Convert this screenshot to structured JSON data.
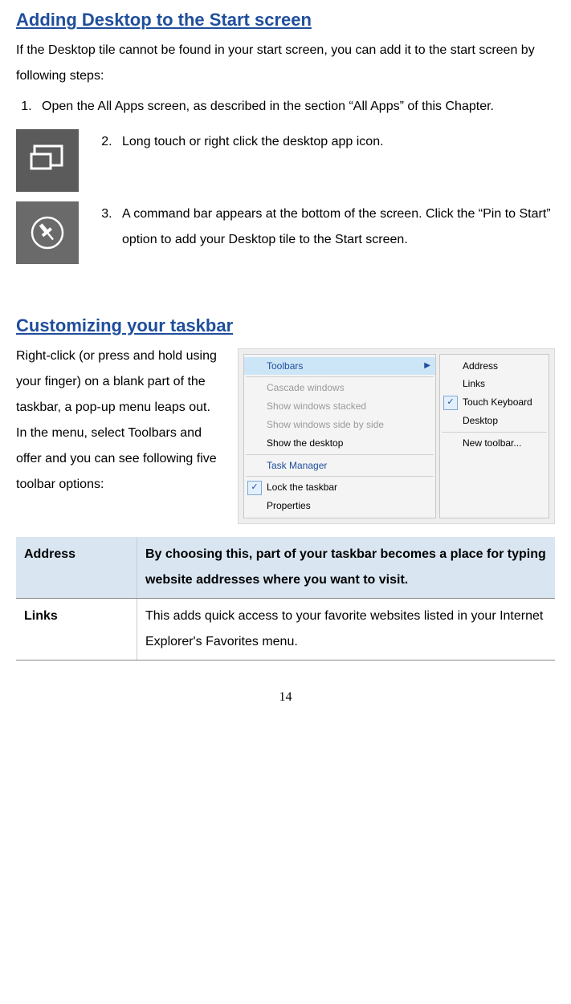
{
  "section1": {
    "heading": "Adding Desktop to the Start screen",
    "intro": "If the Desktop tile cannot be found in your start screen, you can add it to the start screen by following steps:",
    "steps": {
      "s1": "Open the All Apps screen, as described in the section “All Apps” of this Chapter.",
      "s2": "Long touch or right click the desktop app icon.",
      "s3": "A command bar appears at the bottom of the screen. Click the “Pin to Start” option to add your Desktop tile to the Start screen."
    }
  },
  "section2": {
    "heading": "Customizing your taskbar",
    "body": "Right-click (or press and hold using your finger) on a blank part of the taskbar, a pop-up menu leaps out. In the menu, select Toolbars and offer and you can see following five toolbar options:"
  },
  "menu": {
    "main": {
      "toolbars": "Toolbars",
      "cascade": "Cascade windows",
      "stacked": "Show windows stacked",
      "sidebyside": "Show windows side by side",
      "showdesktop": "Show the desktop",
      "taskmgr": "Task Manager",
      "lock": "Lock the taskbar",
      "props": "Properties"
    },
    "sub": {
      "address": "Address",
      "links": "Links",
      "touch": "Touch Keyboard",
      "desktop": "Desktop",
      "newtb": "New toolbar..."
    }
  },
  "table": {
    "rows": [
      {
        "label": "Address",
        "desc": "By choosing this, part of your taskbar becomes a place for typing website addresses where you want to visit."
      },
      {
        "label": "Links",
        "desc": "This adds quick access to your favorite websites listed in your Internet Explorer's Favorites menu."
      }
    ]
  },
  "page": "14"
}
